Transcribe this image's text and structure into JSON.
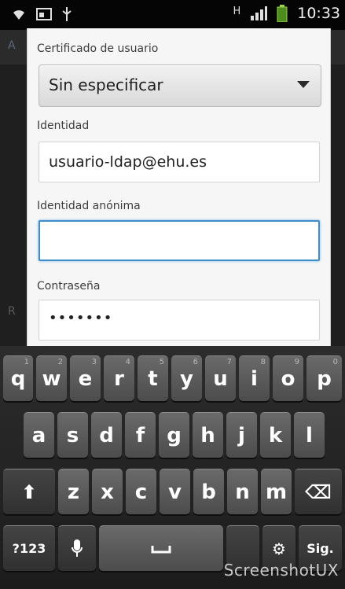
{
  "status_bar": {
    "time": "10:33",
    "network_type": "H"
  },
  "background": {
    "header_text": "A",
    "list_letter": "R"
  },
  "dialog": {
    "cert_label": "Certificado de usuario",
    "cert_value": "Sin especificar",
    "identity_label": "Identidad",
    "identity_value": "usuario-ldap@ehu.es",
    "anon_label": "Identidad anónima",
    "anon_value": "",
    "password_label": "Contraseña",
    "password_value": "•••••••"
  },
  "keyboard": {
    "row1": [
      {
        "k": "q",
        "h": "1"
      },
      {
        "k": "w",
        "h": "2"
      },
      {
        "k": "e",
        "h": "3"
      },
      {
        "k": "r",
        "h": "4"
      },
      {
        "k": "t",
        "h": "5"
      },
      {
        "k": "y",
        "h": "6"
      },
      {
        "k": "u",
        "h": "7"
      },
      {
        "k": "i",
        "h": "8"
      },
      {
        "k": "o",
        "h": "9"
      },
      {
        "k": "p",
        "h": "0"
      }
    ],
    "row2": [
      "a",
      "s",
      "d",
      "f",
      "g",
      "h",
      "j",
      "k",
      "l"
    ],
    "row3": [
      "z",
      "x",
      "c",
      "v",
      "b",
      "n",
      "m"
    ],
    "shift_symbol": "⬆",
    "delete_symbol": "⌫",
    "symbols_label": "?123",
    "settings_symbol": "⚙",
    "next_label": "Sig."
  },
  "watermark": "ScreenshotUX"
}
